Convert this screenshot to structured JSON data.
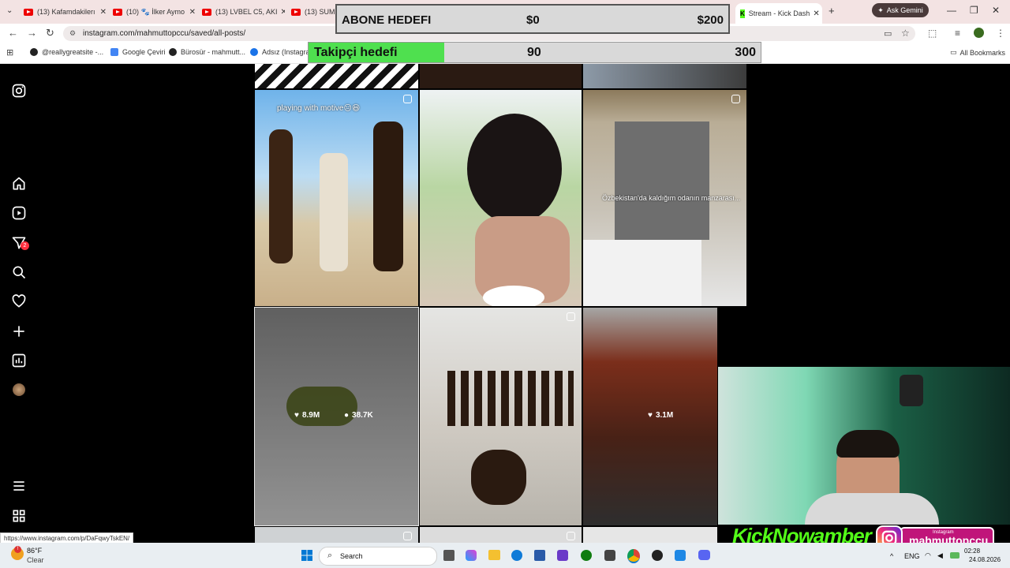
{
  "browser": {
    "tabs": [
      {
        "label": "(13) Kafamdakilerı"
      },
      {
        "label": "(10) 🐾 İlker Aymo"
      },
      {
        "label": "(13) LVBEL C5, AKI"
      },
      {
        "label": "(13) SUMM"
      },
      {
        "label": "Stream - Kick Dash"
      }
    ],
    "new_tab": "+",
    "gemini_label": "Ask Gemini",
    "url": "instagram.com/mahmuttopccu/saved/all-posts/",
    "bookmarks": [
      {
        "label": "@reallygreatsite -..."
      },
      {
        "label": "Google Çeviri"
      },
      {
        "label": "Bürosür - mahmutt..."
      },
      {
        "label": "Adsız (Instagram"
      }
    ],
    "all_bookmarks": "All Bookmarks",
    "status_url": "https://www.instagram.com/p/DaFqwyTskEN/"
  },
  "goals": {
    "subscriber": {
      "label": "ABONE HEDEFI",
      "current": "$0",
      "target": "$200"
    },
    "follower": {
      "label": "Takipçi hedefi",
      "current": "90",
      "target": "300",
      "progress": 0.3
    }
  },
  "sidebar": {
    "icons": [
      "instagram-icon",
      "home-icon",
      "reels-icon",
      "messages-icon",
      "search-icon",
      "heart-icon",
      "create-icon",
      "dashboard-icon",
      "profile-avatar",
      "menu-icon",
      "apps-icon"
    ],
    "messages_badge": "2"
  },
  "posts": {
    "captions": {
      "motive": "playing with motive😑😆",
      "uzbek": "Özbekistan'da kaldığım odanın manzarası..."
    },
    "hover": {
      "likes": "8.9M",
      "comments": "38.7K"
    },
    "third_likes": "3.1M"
  },
  "stream_overlay": {
    "kick_text": "KickNowamber",
    "ig_small": "Instagram",
    "ig_handle": "mahmuttopccu"
  },
  "taskbar": {
    "weather_temp": "86°F",
    "weather_desc": "Clear",
    "search": "Search",
    "lang": "ENG",
    "time": "02:28",
    "date": "24.08.2026"
  },
  "colors": {
    "progress_green": "#4fe04f",
    "kick_green": "#53fc18",
    "badge_red": "#ff3040"
  }
}
